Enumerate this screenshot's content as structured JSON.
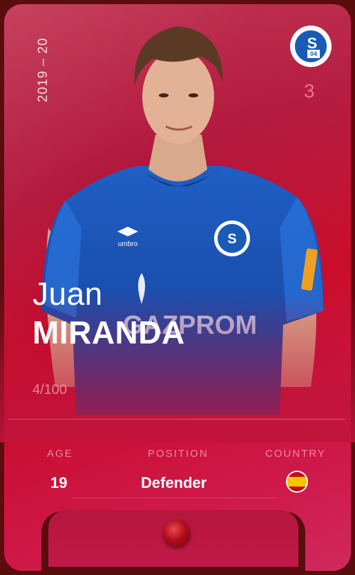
{
  "card": {
    "season": "2019 – 20",
    "rank": "3",
    "first_name": "Juan",
    "last_name": "MIRANDA",
    "serial": "4/100",
    "stats": {
      "age_label": "AGE",
      "age_value": "19",
      "position_label": "POSITION",
      "position_value": "Defender",
      "country_label": "COUNTRY",
      "country_flag": "spain-flag-icon"
    }
  },
  "club": {
    "badge_letters": "S",
    "badge_number": "04"
  },
  "colors": {
    "card_base": "#c80a28",
    "frame": "#5a0d0d",
    "jersey": "#1a5bb5",
    "text_accent": "#e98aa0"
  }
}
